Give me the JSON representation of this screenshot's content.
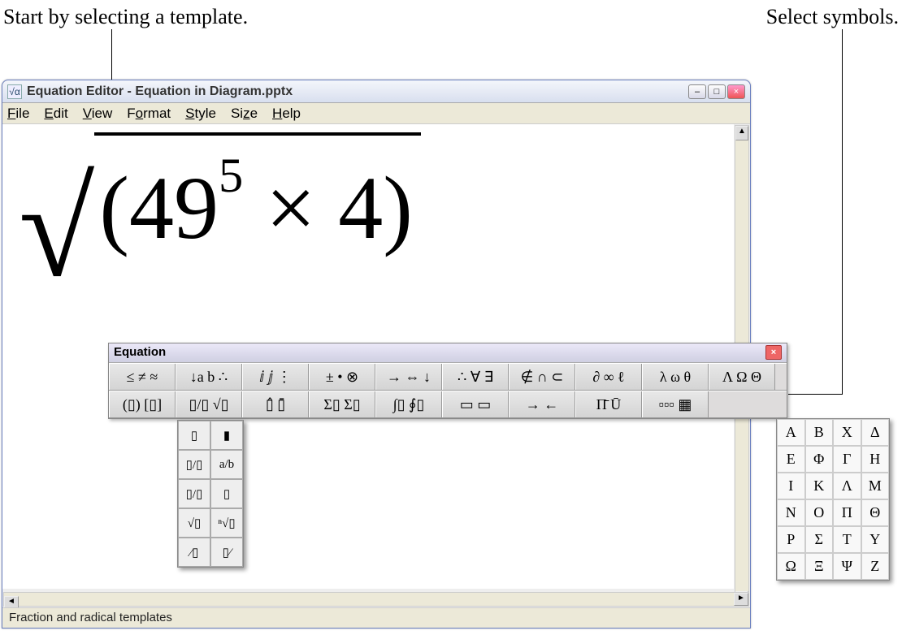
{
  "callouts": {
    "left": "Start by selecting a template.",
    "right": "Select symbols."
  },
  "window": {
    "title": "Equation Editor - Equation in Diagram.pptx",
    "app_icon_glyph": "√α",
    "menu": [
      "File",
      "Edit",
      "View",
      "Format",
      "Style",
      "Size",
      "Help"
    ],
    "controls": {
      "min": "–",
      "max": "□",
      "close": "×"
    }
  },
  "equation": {
    "base": "49",
    "exponent": "5",
    "times": "×",
    "second": "4"
  },
  "toolbar": {
    "title": "Equation",
    "close": "×",
    "row_symbols": [
      "≤ ≠ ≈",
      "↓a b ∴",
      "ⅈ ⅉ ⋮",
      "± • ⊗",
      "→ ⇔ ↓",
      "∴ ∀ ∃",
      "∉ ∩ ⊂",
      "∂ ∞ ℓ",
      "λ ω θ",
      "Λ Ω Θ"
    ],
    "row_templates": [
      "(▯) [▯]",
      "▯/▯ √▯",
      "▯̂ ▯̄",
      "Σ▯ Σ▯",
      "∫▯ ∮▯",
      "▭ ▭",
      "→ ←",
      "Π̄ Ū",
      "▫▫▫ ▦"
    ]
  },
  "template_palette": [
    [
      "▯",
      "▮"
    ],
    [
      "▯/▯",
      "a/b"
    ],
    [
      "▯/▯",
      "▯"
    ],
    [
      "√▯",
      "ⁿ√▯"
    ],
    [
      "⁄▯",
      "▯⁄"
    ]
  ],
  "greek_palette": [
    [
      "Α",
      "Β",
      "Χ",
      "Δ"
    ],
    [
      "Ε",
      "Φ",
      "Γ",
      "Η"
    ],
    [
      "Ι",
      "Κ",
      "Λ",
      "Μ"
    ],
    [
      "Ν",
      "Ο",
      "Π",
      "Θ"
    ],
    [
      "Ρ",
      "Σ",
      "Τ",
      "Υ"
    ],
    [
      "Ω",
      "Ξ",
      "Ψ",
      "Ζ"
    ]
  ],
  "status": "Fraction and radical templates"
}
